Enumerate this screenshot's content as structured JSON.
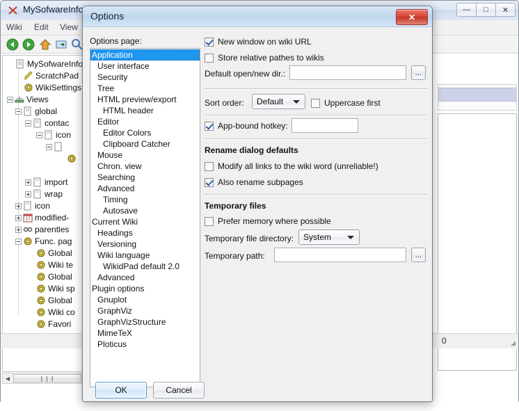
{
  "background_window": {
    "title": "MySofwareInform",
    "title_icon": "pencil-x-icon",
    "window_controls": [
      {
        "name": "minimize",
        "glyph": "—"
      },
      {
        "name": "maximize",
        "glyph": "□"
      },
      {
        "name": "close",
        "glyph": "✕"
      }
    ],
    "menu": [
      "Wiki",
      "Edit",
      "View"
    ],
    "toolbar_icons": [
      "back-icon",
      "forward-icon",
      "home-icon",
      "rename-icon",
      "search-icon"
    ],
    "tree": [
      {
        "label": "MySofwareInfo",
        "icon": "page-icon",
        "indent": 0,
        "expander": "none"
      },
      {
        "label": "ScratchPad",
        "icon": "pencil-icon",
        "indent": 1,
        "expander": "none"
      },
      {
        "label": "WikiSettings",
        "icon": "gear-icon",
        "indent": 1,
        "expander": "none"
      },
      {
        "label": "Views",
        "icon": "views-icon",
        "indent": 0,
        "expander": "minus"
      },
      {
        "label": "global",
        "icon": "page-icon",
        "indent": 1,
        "expander": "minus"
      },
      {
        "label": "contac",
        "icon": "page-icon",
        "indent": 2,
        "expander": "minus"
      },
      {
        "label": "icon",
        "icon": "page-icon",
        "indent": 3,
        "expander": "minus"
      },
      {
        "label": "",
        "icon": "page-icon",
        "indent": 4,
        "expander": "minus"
      },
      {
        "label": "",
        "icon": "gear-icon",
        "indent": 5,
        "expander": "none"
      },
      {
        "label": "import",
        "icon": "page-icon",
        "indent": 2,
        "expander": "plus"
      },
      {
        "label": "wrap",
        "icon": "page-icon",
        "indent": 2,
        "expander": "plus"
      },
      {
        "label": "icon",
        "icon": "page-icon",
        "indent": 1,
        "expander": "plus"
      },
      {
        "label": "modified-",
        "icon": "calendar-icon",
        "indent": 1,
        "expander": "plus"
      },
      {
        "label": "parentles",
        "icon": "glasses-icon",
        "indent": 1,
        "expander": "plus"
      },
      {
        "label": "Func. pag",
        "icon": "gear-icon",
        "indent": 1,
        "expander": "minus"
      },
      {
        "label": "Global",
        "icon": "gear-icon",
        "indent": 2,
        "expander": "none"
      },
      {
        "label": "Wiki te",
        "icon": "gear-icon",
        "indent": 2,
        "expander": "none"
      },
      {
        "label": "Global",
        "icon": "gear-icon",
        "indent": 2,
        "expander": "none"
      },
      {
        "label": "Wiki sp",
        "icon": "gear-icon",
        "indent": 2,
        "expander": "none"
      },
      {
        "label": "Global",
        "icon": "gear-icon",
        "indent": 2,
        "expander": "none"
      },
      {
        "label": "Wiki co",
        "icon": "gear-icon",
        "indent": 2,
        "expander": "none"
      },
      {
        "label": "Favori",
        "icon": "gear-icon",
        "indent": 2,
        "expander": "none"
      }
    ],
    "status_text": "0",
    "hscroll": {
      "left_arrow": "◀",
      "thumb_grip": "❙❙❙"
    }
  },
  "dialog": {
    "title": "Options",
    "close_label": "✕",
    "options_page_label": "Options page:",
    "options_list": [
      {
        "label": "Application",
        "indent": 0,
        "selected": true
      },
      {
        "label": "User interface",
        "indent": 1,
        "selected": false
      },
      {
        "label": "Security",
        "indent": 1,
        "selected": false
      },
      {
        "label": "Tree",
        "indent": 1,
        "selected": false
      },
      {
        "label": "HTML preview/export",
        "indent": 1,
        "selected": false
      },
      {
        "label": "HTML header",
        "indent": 2,
        "selected": false
      },
      {
        "label": "Editor",
        "indent": 1,
        "selected": false
      },
      {
        "label": "Editor Colors",
        "indent": 2,
        "selected": false
      },
      {
        "label": "Clipboard Catcher",
        "indent": 2,
        "selected": false
      },
      {
        "label": "Mouse",
        "indent": 1,
        "selected": false
      },
      {
        "label": "Chron. view",
        "indent": 1,
        "selected": false
      },
      {
        "label": "Searching",
        "indent": 1,
        "selected": false
      },
      {
        "label": "Advanced",
        "indent": 1,
        "selected": false
      },
      {
        "label": "Timing",
        "indent": 2,
        "selected": false
      },
      {
        "label": "Autosave",
        "indent": 2,
        "selected": false
      },
      {
        "label": "Current Wiki",
        "indent": 0,
        "selected": false
      },
      {
        "label": "Headings",
        "indent": 1,
        "selected": false
      },
      {
        "label": "Versioning",
        "indent": 1,
        "selected": false
      },
      {
        "label": "Wiki language",
        "indent": 1,
        "selected": false
      },
      {
        "label": "WikidPad default 2.0",
        "indent": 2,
        "selected": false
      },
      {
        "label": "Advanced",
        "indent": 1,
        "selected": false
      },
      {
        "label": "Plugin options",
        "indent": 0,
        "selected": false
      },
      {
        "label": "Gnuplot",
        "indent": 1,
        "selected": false
      },
      {
        "label": "GraphViz",
        "indent": 1,
        "selected": false
      },
      {
        "label": "GraphVizStructure",
        "indent": 1,
        "selected": false
      },
      {
        "label": "MimeTeX",
        "indent": 1,
        "selected": false
      },
      {
        "label": "Ploticus",
        "indent": 1,
        "selected": false
      }
    ],
    "panel": {
      "new_window_on_wiki_url": {
        "label": "New window on wiki URL",
        "checked": true
      },
      "store_relative_pathes": {
        "label": "Store relative pathes to wikis",
        "checked": false
      },
      "default_dir_label": "Default open/new dir.:",
      "default_dir_value": "",
      "default_dir_browse": "...",
      "sort_order_label": "Sort order:",
      "sort_order_value": "Default",
      "uppercase_first": {
        "label": "Uppercase first",
        "checked": false
      },
      "app_bound_hotkey": {
        "label": "App-bound hotkey:",
        "checked": true
      },
      "app_bound_hotkey_value": "",
      "rename_section_title": "Rename dialog defaults",
      "modify_all_links": {
        "label": "Modify all links to the wiki word (unreliable!)",
        "checked": false
      },
      "also_rename_subpages": {
        "label": "Also rename subpages",
        "checked": true
      },
      "temporary_section_title": "Temporary files",
      "prefer_memory": {
        "label": "Prefer memory where possible",
        "checked": false
      },
      "temp_dir_label": "Temporary file directory:",
      "temp_dir_value": "System",
      "temp_path_label": "Temporary path:",
      "temp_path_value": "",
      "temp_path_browse": "..."
    },
    "ok_label": "OK",
    "cancel_label": "Cancel"
  },
  "colors": {
    "selection_blue": "#1f96f0",
    "close_red": "#c33527",
    "dialog_bg": "#f0f0f0"
  }
}
